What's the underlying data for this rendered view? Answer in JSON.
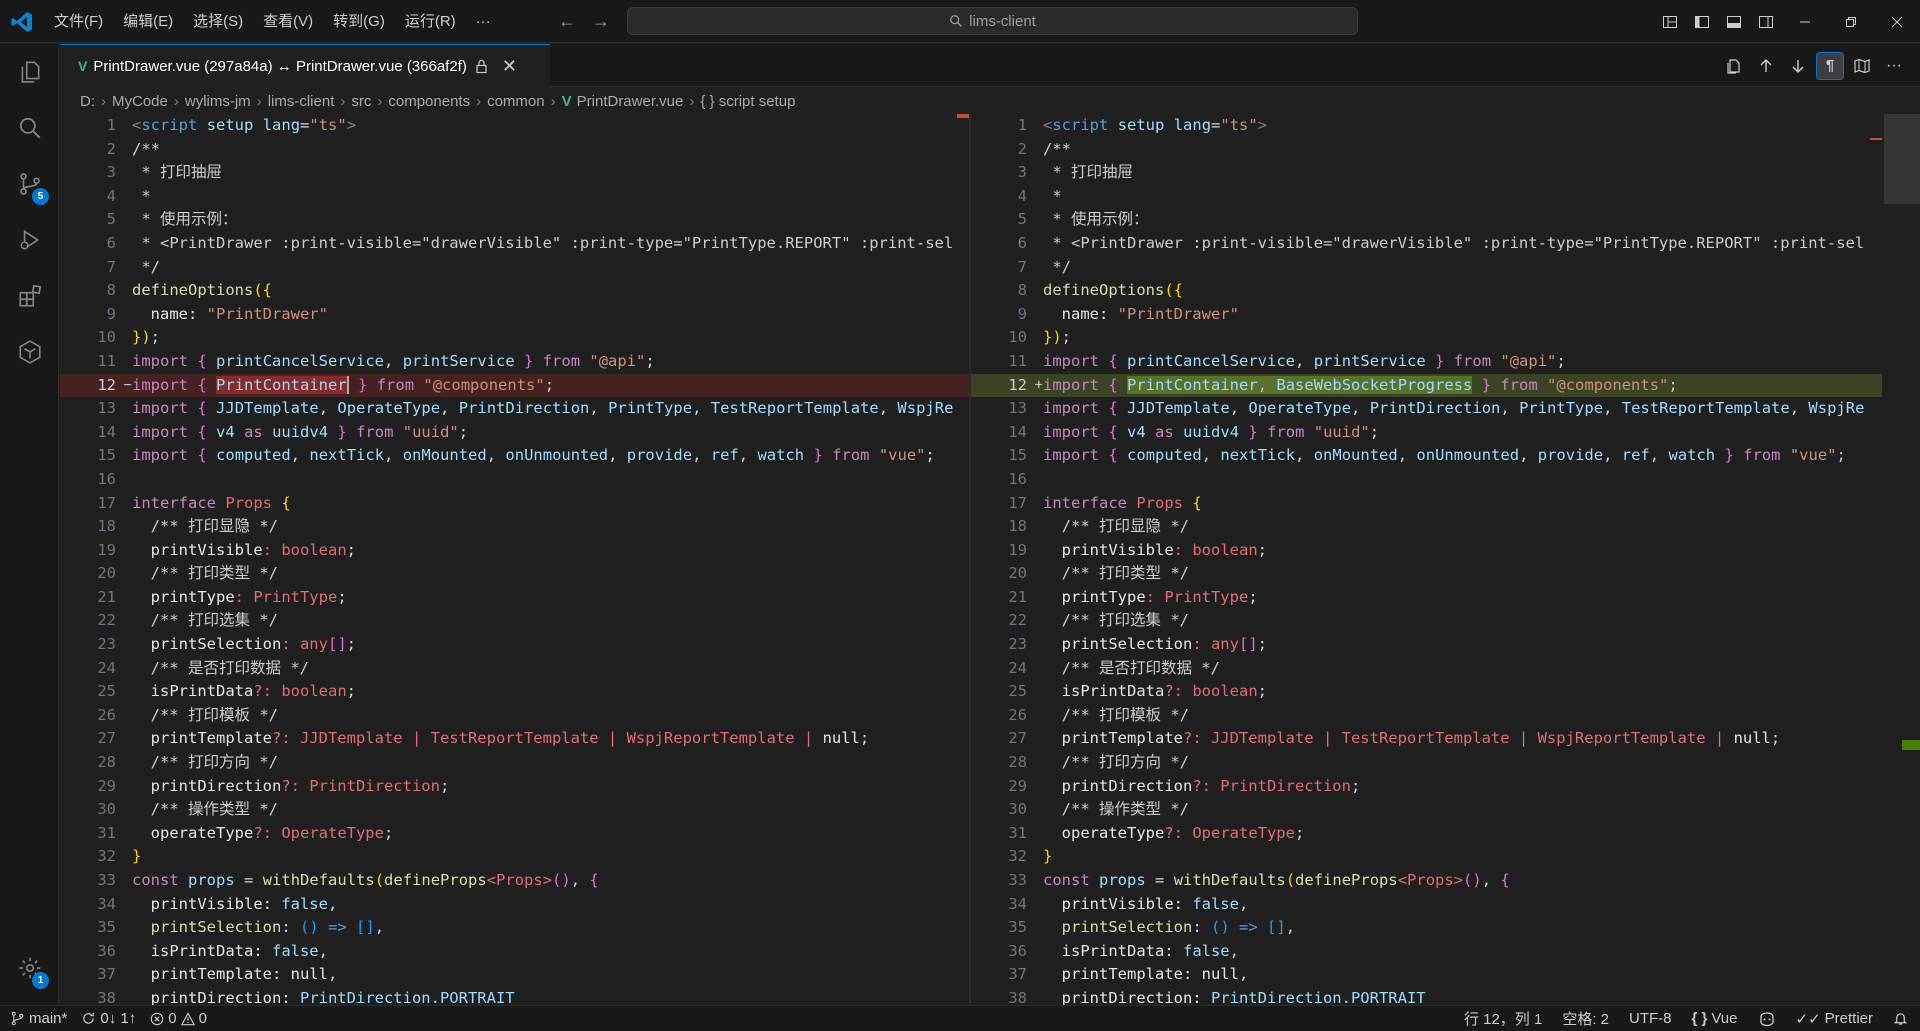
{
  "titlebar": {
    "menus": [
      "文件(F)",
      "编辑(E)",
      "选择(S)",
      "查看(V)",
      "转到(G)",
      "运行(R)",
      "···"
    ],
    "search_text": "lims-client"
  },
  "activity_bar": {
    "items": [
      "explorer-icon",
      "search-icon",
      "source-control-icon",
      "run-debug-icon",
      "extensions-icon",
      "remote-icon"
    ],
    "source_control_badge": "5",
    "settings_badge": "1"
  },
  "tab": {
    "title": "PrintDrawer.vue (297a84a) ↔ PrintDrawer.vue (366af2f)"
  },
  "breadcrumb": {
    "items": [
      "D:",
      "MyCode",
      "wylims-jm",
      "lims-client",
      "src",
      "components",
      "common"
    ],
    "file": "PrintDrawer.vue",
    "symbol": "{ } script setup"
  },
  "editor_left": {
    "line_numbers": [
      "1",
      "2",
      "3",
      "4",
      "5",
      "6",
      "7",
      "8",
      "9",
      "10",
      "11",
      "12",
      "13",
      "14",
      "15",
      "16",
      "17",
      "18",
      "19",
      "20",
      "21",
      "22",
      "23",
      "24",
      "25",
      "26",
      "27",
      "28",
      "29",
      "30",
      "31",
      "32",
      "33",
      "34",
      "35",
      "36",
      "37",
      "38"
    ],
    "changed_line_marker": "−"
  },
  "editor_right": {
    "line_numbers": [
      "1",
      "2",
      "3",
      "4",
      "5",
      "6",
      "7",
      "8",
      "9",
      "10",
      "11",
      "12",
      "13",
      "14",
      "15",
      "16",
      "17",
      "18",
      "19",
      "20",
      "21",
      "22",
      "23",
      "24",
      "25",
      "26",
      "27",
      "28",
      "29",
      "30",
      "31",
      "32",
      "33",
      "34",
      "35",
      "36",
      "37",
      "38"
    ],
    "changed_line_marker": "+"
  },
  "code_text": {
    "l1_script": "<script setup lang=\"ts\">",
    "l2": "/**",
    "l3": " * 打印抽屉",
    "l4": " *",
    "l5": " * 使用示例：",
    "l6": " * <PrintDrawer :print-visible=\"drawerVisible\" :print-type=\"PrintType.REPORT\" :print-sel",
    "l7": " */",
    "l8": "defineOptions({",
    "l9_key": "  name: ",
    "l9_val": "\"PrintDrawer\"",
    "l10": "});",
    "l11": "import { printCancelService, printService } from \"@api\";",
    "l12_left_a": "import { ",
    "l12_left_b": "PrintContainer",
    "l12_left_c": " } from \"@components\";",
    "l12_right_b": "PrintContainer, BaseWebSocketProgress",
    "l13_left": "import { JJDTemplate, OperateType, PrintDirection, PrintType, TestReportTemplate, WspjRe",
    "l13_right": "import { JJDTemplate, OperateType, PrintDirection, PrintType, TestReportTemplate, WspjRe",
    "l14": "import { v4 as uuidv4 } from \"uuid\";",
    "l15": "import { computed, nextTick, onMounted, onUnmounted, provide, ref, watch } from \"vue\";",
    "l17": "interface Props {",
    "l18": "  /** 打印显隐 */",
    "l19": "  printVisible: boolean;",
    "l20": "  /** 打印类型 */",
    "l21": "  printType: PrintType;",
    "l22": "  /** 打印选集 */",
    "l23": "  printSelection: any[];",
    "l24": "  /** 是否打印数据 */",
    "l25": "  isPrintData?: boolean;",
    "l26": "  /** 打印模板 */",
    "l27": "  printTemplate?: JJDTemplate | TestReportTemplate | WspjReportTemplate | null;",
    "l28": "  /** 打印方向 */",
    "l29": "  printDirection?: PrintDirection;",
    "l30": "  /** 操作类型 */",
    "l31": "  operateType?: OperateType;",
    "l32": "}",
    "l33": "const props = withDefaults(defineProps<Props>(), {",
    "l34": "  printVisible: false,",
    "l35": "  printSelection: () => [],",
    "l36": "  isPrintData: false,",
    "l37": "  printTemplate: null,",
    "l38": "  printDirection: PrintDirection.PORTRAIT"
  },
  "statusbar": {
    "branch": "main*",
    "sync": "0↓ 1↑",
    "errors": "0",
    "warnings": "0",
    "position": "行 12，列 1",
    "spaces": "空格: 2",
    "encoding": "UTF-8",
    "language": "Vue",
    "prettier": "Prettier"
  },
  "colors": {
    "accent": "#0078d4",
    "deleted_line": "#5a2a2a",
    "inserted_line": "#4b5a28",
    "vue_green": "#41b883"
  }
}
